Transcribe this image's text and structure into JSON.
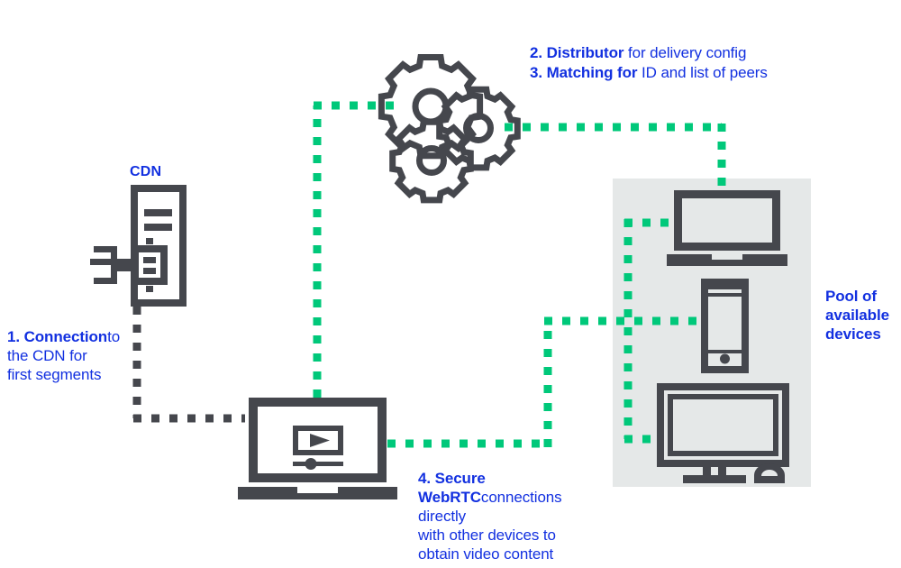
{
  "diagram": {
    "title_colors": {
      "text_blue": "#1230e0",
      "icon_dark": "#45474d",
      "dash_green": "#00c87a",
      "pool_background": "#e5e8e8",
      "page_background": "#ffffff"
    },
    "labels": {
      "cdn": "CDN",
      "step1": {
        "strong": "1. Connection",
        "rest": "to the CDN for\nfirst segments"
      },
      "step2": {
        "strong": "2. Distributor",
        "rest": " for delivery config"
      },
      "step3": {
        "strong": "3. Matching for",
        "rest": " ID and list of peers"
      },
      "step4": {
        "strong": "4. Secure WebRTC",
        "rest": "connections directly\nwith other devices to\nobtain video content"
      },
      "pool": "Pool of\navailable\ndevices"
    },
    "nodes": {
      "cdn_server": "cdn-server-icon",
      "gears": "gears-icon",
      "player_laptop": "video-player-laptop-icon",
      "pool_laptop": "laptop-device-icon",
      "pool_phone": "smartphone-device-icon",
      "pool_tv": "television-device-icon"
    },
    "connections": [
      {
        "name": "cdn-to-player",
        "style": "dashed-dark",
        "from": "cdn-server",
        "to": "video-player-laptop"
      },
      {
        "name": "player-to-gears",
        "style": "dashed-green",
        "from": "video-player-laptop",
        "to": "gears"
      },
      {
        "name": "gears-to-pool-laptop",
        "style": "dashed-green",
        "from": "gears",
        "to": "pool-laptop"
      },
      {
        "name": "player-to-pool-devices",
        "style": "dashed-green",
        "from": "video-player-laptop",
        "to": "pool-devices"
      }
    ]
  }
}
